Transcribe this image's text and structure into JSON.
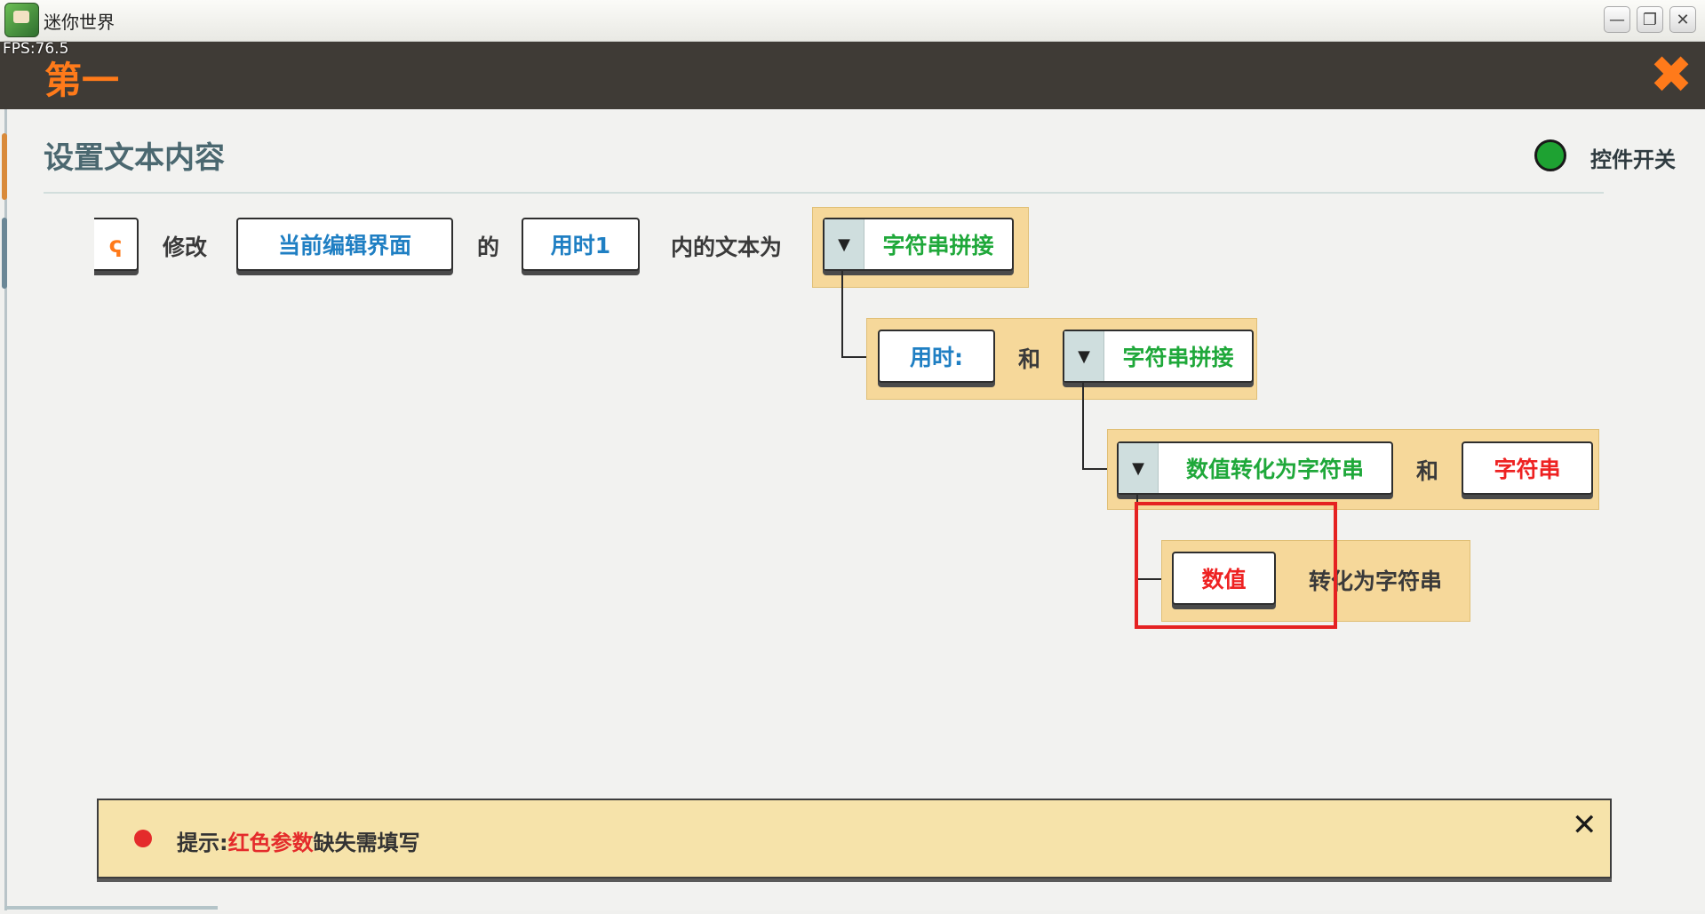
{
  "window": {
    "title": "迷你世界",
    "fps": "FPS:76.5",
    "minimize": "—",
    "restore": "❐",
    "close": "✕"
  },
  "header": {
    "title": "第一",
    "close": "✖"
  },
  "content": {
    "title": "设置文本内容",
    "switch_label": "控件开关",
    "switch_color": "#1ea232"
  },
  "statement": {
    "cut_left": "ҁ",
    "modify": "修改",
    "target": "当前编辑界面",
    "of": "的",
    "element": "用时1",
    "text_to": "内的文本为",
    "concat1": "字符串拼接",
    "arg1": "用时:",
    "and1": "和",
    "concat2": "字符串拼接",
    "num_to_str": "数值转化为字符串",
    "and2": "和",
    "string_param": "字符串",
    "number_param": "数值",
    "convert_label": "转化为字符串"
  },
  "hint": {
    "prefix": "提示:",
    "highlight": "红色参数",
    "suffix": "缺失需填写",
    "close": "✕"
  },
  "colors": {
    "accent": "#ff7a1a",
    "param_blue": "#1f7fc3",
    "func_green": "#1fa83a",
    "missing_red": "#ee2222"
  }
}
